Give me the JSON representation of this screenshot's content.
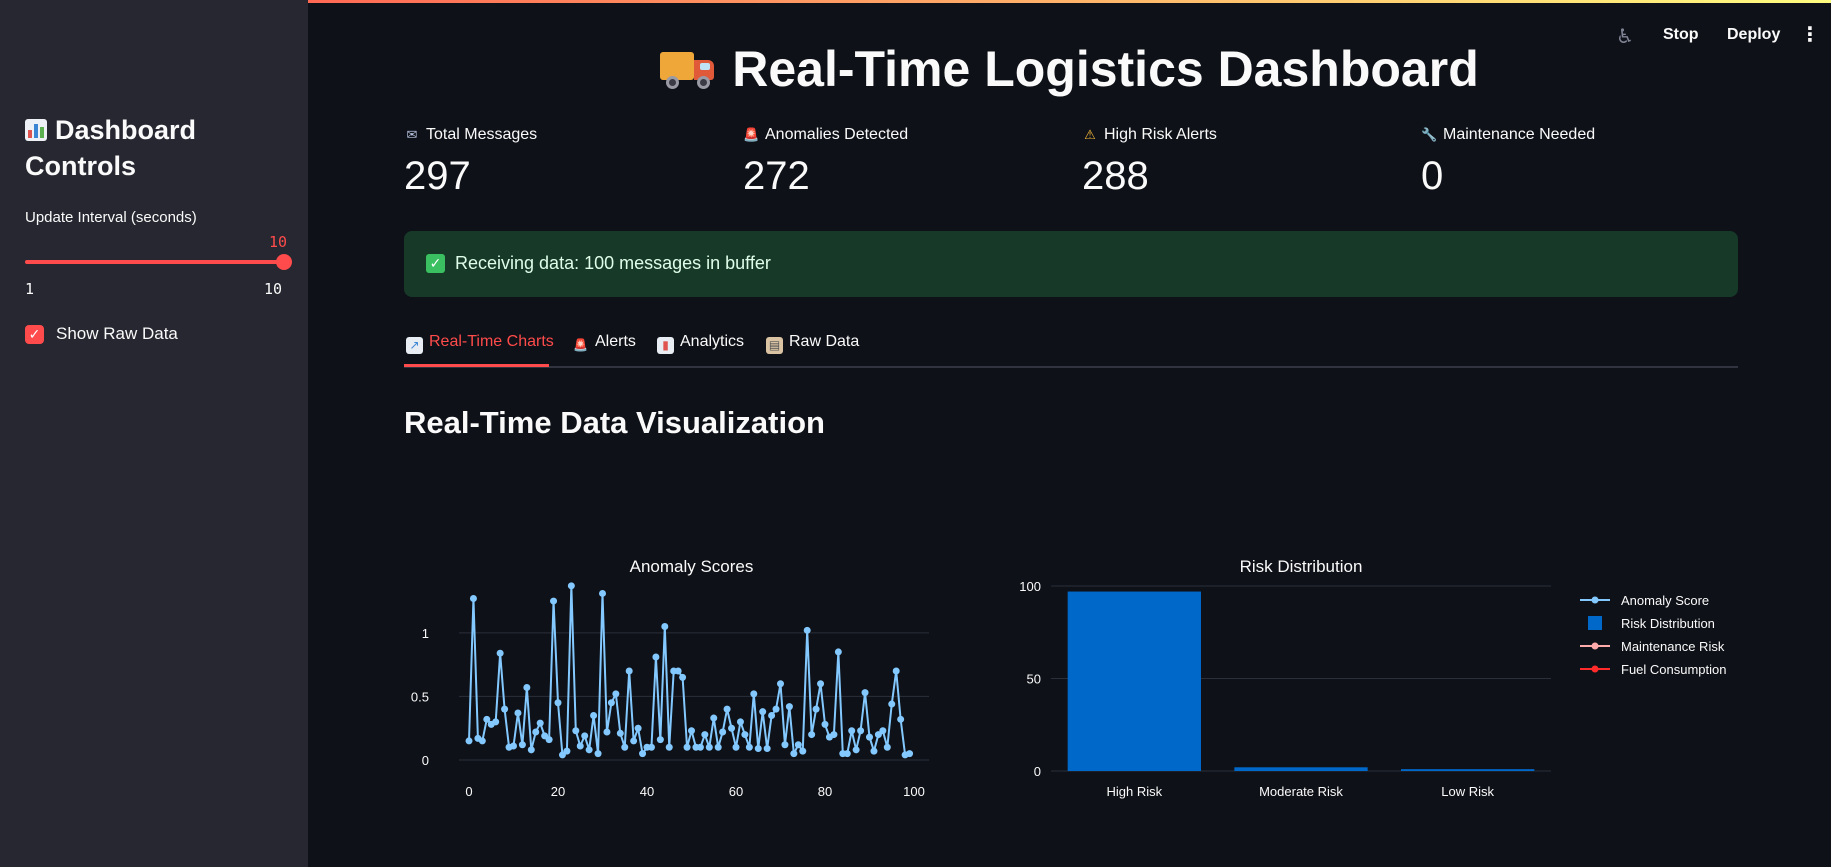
{
  "sidebar": {
    "title": "Dashboard Controls",
    "slider_label": "Update Interval (seconds)",
    "slider_value": "10",
    "slider_min": "1",
    "slider_max": "10",
    "show_raw_label": "Show Raw Data",
    "show_raw_checked": true
  },
  "toolbar": {
    "stop_label": "Stop",
    "deploy_label": "Deploy"
  },
  "header": {
    "title": "Real-Time Logistics Dashboard"
  },
  "metrics": [
    {
      "label": "Total Messages",
      "value": "297",
      "icon": "envelope-icon"
    },
    {
      "label": "Anomalies Detected",
      "value": "272",
      "icon": "siren-icon"
    },
    {
      "label": "High Risk Alerts",
      "value": "288",
      "icon": "warning-icon"
    },
    {
      "label": "Maintenance Needed",
      "value": "0",
      "icon": "wrench-icon"
    }
  ],
  "status": {
    "text": "Receiving data: 100 messages in buffer"
  },
  "tabs": [
    {
      "label": "Real-Time Charts",
      "icon": "chart-up-icon",
      "active": true
    },
    {
      "label": "Alerts",
      "icon": "siren-icon",
      "active": false
    },
    {
      "label": "Analytics",
      "icon": "bar-chart-icon",
      "active": false
    },
    {
      "label": "Raw Data",
      "icon": "clipboard-icon",
      "active": false
    }
  ],
  "section": {
    "title": "Real-Time Data Visualization"
  },
  "colors": {
    "accent": "#ff4b4b",
    "line_series": "#83c9ff",
    "bar_series": "#0068c9",
    "maintenance": "#ffabab",
    "fuel": "#ff2b2b"
  },
  "chart_data": [
    {
      "type": "line",
      "title": "Anomaly Scores",
      "xlim": [
        0,
        100
      ],
      "ylim": [
        0,
        1.4
      ],
      "xticks": [
        "0",
        "20",
        "40",
        "60",
        "80",
        "100"
      ],
      "yticks": [
        "0",
        "0.5",
        "1"
      ],
      "series": [
        {
          "name": "Anomaly Score",
          "values": [
            0.15,
            1.27,
            0.17,
            0.15,
            0.32,
            0.28,
            0.3,
            0.84,
            0.4,
            0.1,
            0.11,
            0.37,
            0.12,
            0.57,
            0.08,
            0.22,
            0.29,
            0.19,
            0.16,
            1.25,
            0.45,
            0.04,
            0.07,
            1.37,
            0.23,
            0.11,
            0.19,
            0.08,
            0.35,
            0.05,
            1.31,
            0.22,
            0.45,
            0.52,
            0.21,
            0.1,
            0.7,
            0.15,
            0.25,
            0.05,
            0.1,
            0.1,
            0.81,
            0.16,
            1.05,
            0.1,
            0.7,
            0.7,
            0.65,
            0.1,
            0.23,
            0.1,
            0.1,
            0.2,
            0.1,
            0.33,
            0.1,
            0.22,
            0.4,
            0.25,
            0.1,
            0.3,
            0.2,
            0.1,
            0.52,
            0.09,
            0.38,
            0.09,
            0.35,
            0.4,
            0.6,
            0.12,
            0.42,
            0.05,
            0.12,
            0.07,
            1.02,
            0.2,
            0.4,
            0.6,
            0.28,
            0.18,
            0.2,
            0.85,
            0.05,
            0.05,
            0.23,
            0.08,
            0.23,
            0.53,
            0.18,
            0.07,
            0.2,
            0.23,
            0.1,
            0.44,
            0.7,
            0.32,
            0.04,
            0.05
          ]
        }
      ]
    },
    {
      "type": "bar",
      "title": "Risk Distribution",
      "categories": [
        "High Risk",
        "Moderate Risk",
        "Low Risk"
      ],
      "values": [
        97,
        2,
        1
      ],
      "ylim": [
        0,
        100
      ],
      "yticks": [
        "0",
        "50",
        "100"
      ],
      "legend": {
        "placement": "right",
        "entries": [
          "Anomaly Score",
          "Risk Distribution",
          "Maintenance Risk",
          "Fuel Consumption"
        ]
      }
    }
  ]
}
